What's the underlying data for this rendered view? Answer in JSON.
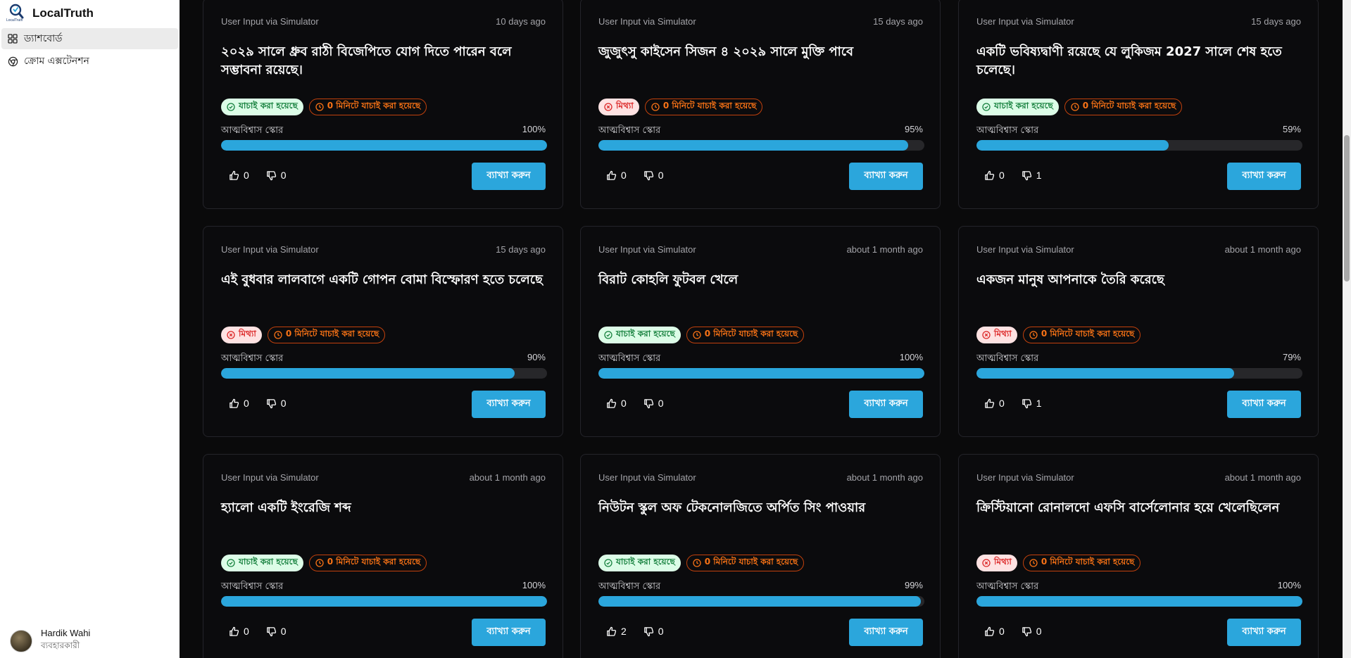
{
  "app": {
    "name": "LocalTruth",
    "logo_text": "LocalTruth"
  },
  "sidebar": {
    "items": [
      {
        "label": "ড্যাশবোর্ড",
        "icon": "dashboard-icon",
        "active": true
      },
      {
        "label": "ক্রোম এক্সটেনশন",
        "icon": "chrome-icon",
        "active": false
      }
    ],
    "user": {
      "name": "Hardik Wahi",
      "role": "ব্যবহারকারী"
    }
  },
  "labels": {
    "confidence": "আত্মবিশ্বাস স্কোর",
    "explain": "ব্যাখ্যা করুন",
    "verified": "যাচাই করা হয়েছে",
    "false": "মিথ্যা",
    "time": "0 মিনিটে যাচাই করা হয়েছে"
  },
  "colors": {
    "accent": "#2ba6dc",
    "verified": "#15803d",
    "false": "#dc2626",
    "time": "#f97316"
  },
  "cards": [
    {
      "source": "User Input via Simulator",
      "ago": "10 days ago",
      "title": "২০২৯ সালে ধ্রুব রাঠী বিজেপিতে যোগ দিতে পারেন বলে সম্ভাবনা রয়েছে।",
      "status": "verified",
      "confidence": "100%",
      "confidence_value": 1.0,
      "up": "0",
      "down": "0"
    },
    {
      "source": "User Input via Simulator",
      "ago": "15 days ago",
      "title": "জুজুৎসু কাইসেন সিজন ৪ ২০২৯ সালে মুক্তি পাবে",
      "status": "false",
      "confidence": "95%",
      "confidence_value": 0.95,
      "up": "0",
      "down": "0"
    },
    {
      "source": "User Input via Simulator",
      "ago": "15 days ago",
      "title": "একটি ভবিষ্যদ্বাণী রয়েছে যে লুকিজম 2027 সালে শেষ হতে চলেছে।",
      "status": "verified",
      "confidence": "59%",
      "confidence_value": 0.59,
      "up": "0",
      "down": "1"
    },
    {
      "source": "User Input via Simulator",
      "ago": "15 days ago",
      "title": "এই বুধবার লালবাগে একটি গোপন বোমা বিস্ফোরণ হতে চলেছে",
      "status": "false",
      "confidence": "90%",
      "confidence_value": 0.9,
      "up": "0",
      "down": "0"
    },
    {
      "source": "User Input via Simulator",
      "ago": "about 1 month ago",
      "title": "বিরাট কোহলি ফুটবল খেলে",
      "status": "verified",
      "confidence": "100%",
      "confidence_value": 1.0,
      "up": "0",
      "down": "0"
    },
    {
      "source": "User Input via Simulator",
      "ago": "about 1 month ago",
      "title": "একজন মানুষ আপনাকে তৈরি করেছে",
      "status": "false",
      "confidence": "79%",
      "confidence_value": 0.79,
      "up": "0",
      "down": "1"
    },
    {
      "source": "User Input via Simulator",
      "ago": "about 1 month ago",
      "title": "হ্যালো একটি ইংরেজি শব্দ",
      "status": "verified",
      "confidence": "100%",
      "confidence_value": 1.0,
      "up": "0",
      "down": "0"
    },
    {
      "source": "User Input via Simulator",
      "ago": "about 1 month ago",
      "title": "নিউটন স্কুল অফ টেকনোলজিতে অর্পিত সিং পাওয়ার",
      "status": "verified",
      "confidence": "99%",
      "confidence_value": 0.99,
      "up": "2",
      "down": "0"
    },
    {
      "source": "User Input via Simulator",
      "ago": "about 1 month ago",
      "title": "ক্রিস্টিয়ানো রোনালদো এফসি বার্সেলোনার হয়ে খেলেছিলেন",
      "status": "false",
      "confidence": "100%",
      "confidence_value": 1.0,
      "up": "0",
      "down": "0"
    }
  ]
}
